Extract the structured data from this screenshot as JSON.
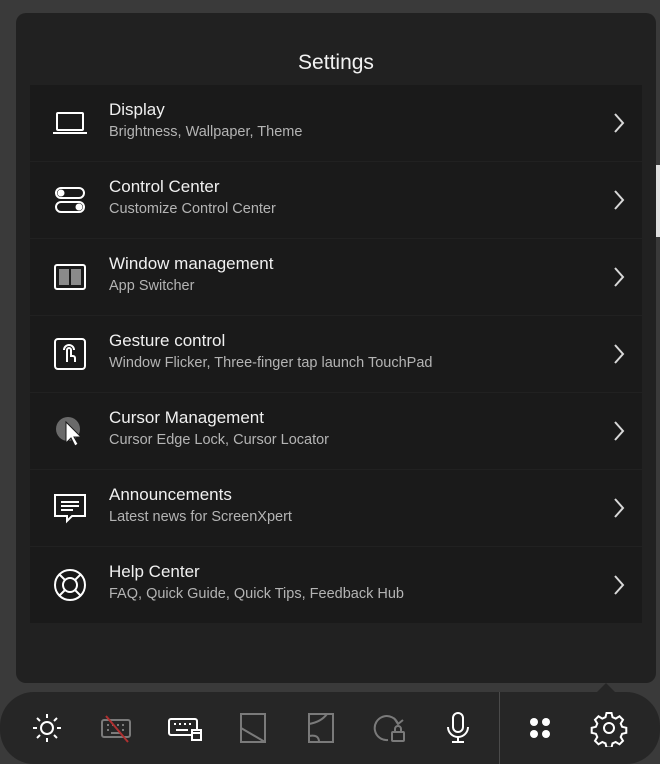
{
  "settings": {
    "title": "Settings",
    "items": [
      {
        "title": "Display",
        "subtitle": "Brightness, Wallpaper, Theme",
        "icon": "laptop-icon"
      },
      {
        "title": "Control Center",
        "subtitle": "Customize Control Center",
        "icon": "toggles-icon"
      },
      {
        "title": "Window management",
        "subtitle": "App Switcher",
        "icon": "window-split-icon"
      },
      {
        "title": "Gesture control",
        "subtitle": "Window Flicker, Three-finger tap launch TouchPad",
        "icon": "touch-gesture-icon"
      },
      {
        "title": "Cursor Management",
        "subtitle": "Cursor Edge Lock, Cursor Locator",
        "icon": "cursor-icon"
      },
      {
        "title": "Announcements",
        "subtitle": "Latest news for ScreenXpert",
        "icon": "message-icon"
      },
      {
        "title": "Help Center",
        "subtitle": "FAQ, Quick Guide, Quick Tips, Feedback Hub",
        "icon": "lifebuoy-icon"
      }
    ]
  },
  "taskbar": {
    "buttons": [
      {
        "icon": "brightness-icon",
        "state": "enabled"
      },
      {
        "icon": "keyboard-disabled-icon",
        "state": "disabled"
      },
      {
        "icon": "keyboard-window-icon",
        "state": "enabled"
      },
      {
        "icon": "screen-split-icon",
        "state": "disabled"
      },
      {
        "icon": "screen-corner-icon",
        "state": "disabled"
      },
      {
        "icon": "rotation-lock-icon",
        "state": "disabled"
      },
      {
        "icon": "microphone-icon",
        "state": "enabled"
      },
      {
        "icon": "apps-grid-icon",
        "state": "enabled"
      },
      {
        "icon": "settings-gear-icon",
        "state": "active"
      }
    ]
  },
  "colors": {
    "panel_bg": "#212121",
    "item_bg": "#1a1a1a",
    "text_primary": "#f0f0f0",
    "text_secondary": "#b4b4b4",
    "icon_enabled": "#ffffff",
    "icon_disabled": "#7a7a7a",
    "disabled_slash": "#b03030"
  }
}
